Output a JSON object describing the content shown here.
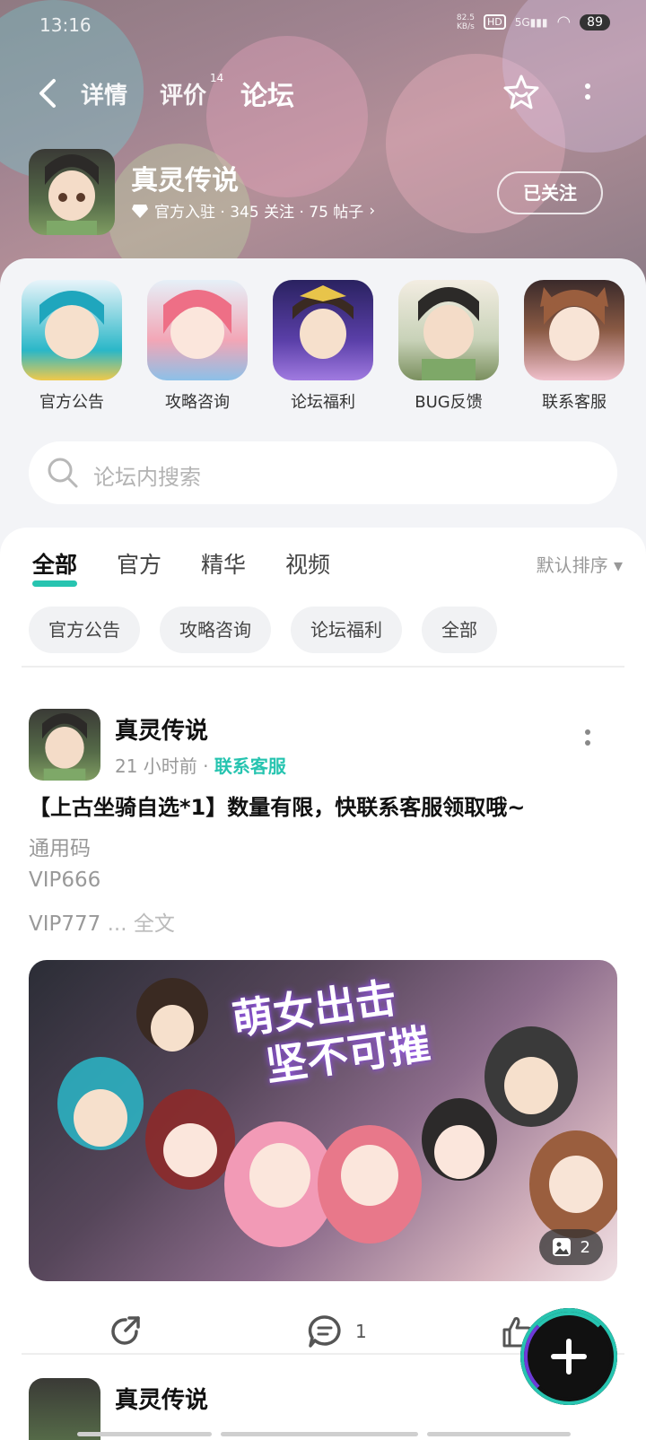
{
  "status_bar": {
    "time": "13:16",
    "speed": "82.5\nKB/s",
    "hd": "HD",
    "network": "5G",
    "battery": "89"
  },
  "nav": {
    "tabs": [
      {
        "label": "详情"
      },
      {
        "label": "评价",
        "badge": "14"
      },
      {
        "label": "论坛",
        "active": true
      }
    ]
  },
  "game": {
    "title": "真灵传说",
    "meta": "官方入驻 · 345 关注 · 75 帖子",
    "follow_label": "已关注"
  },
  "categories": [
    {
      "label": "官方公告",
      "color": "#2ab7c8"
    },
    {
      "label": "攻略咨询",
      "color": "#e8788a"
    },
    {
      "label": "论坛福利",
      "color": "#6a4bb0"
    },
    {
      "label": "BUG反馈",
      "color": "#7a8f5e"
    },
    {
      "label": "联系客服",
      "color": "#b07a5a"
    }
  ],
  "search": {
    "placeholder": "论坛内搜索"
  },
  "feed": {
    "tabs": [
      {
        "label": "全部",
        "active": true
      },
      {
        "label": "官方"
      },
      {
        "label": "精华"
      },
      {
        "label": "视频"
      }
    ],
    "sort_label": "默认排序 ▾",
    "chips": [
      "官方公告",
      "攻略咨询",
      "论坛福利",
      "全部"
    ]
  },
  "post": {
    "author": "真灵传说",
    "time": "21 小时前 ·",
    "tag": "联系客服",
    "title": "【上古坐骑自选*1】数量有限，快联系客服领取哦~",
    "lines": [
      "通用码",
      "VIP666",
      "VIP777"
    ],
    "ellipsis": " ... ",
    "full_text": "全文",
    "image_title_line1": "萌女出击",
    "image_title_line2": "坚不可摧",
    "image_count": "2",
    "comment_count": "1"
  },
  "next_post": {
    "author": "真灵传说"
  },
  "colors": {
    "accent": "#27c4b0",
    "tag": "#27c4b0"
  }
}
